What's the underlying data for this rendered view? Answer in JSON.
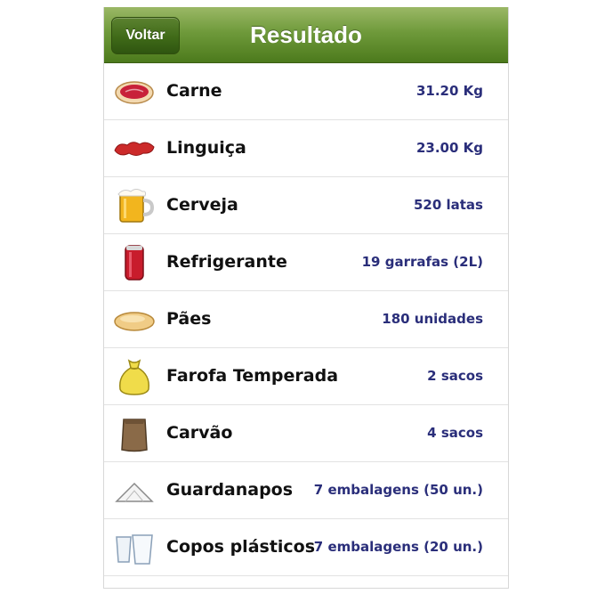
{
  "navbar": {
    "back_label": "Voltar",
    "title": "Resultado",
    "bar_color": "#5e8a2c"
  },
  "items": [
    {
      "label": "Carne",
      "value": "31.20 Kg",
      "icon": "steak-icon"
    },
    {
      "label": "Linguiça",
      "value": "23.00 Kg",
      "icon": "sausage-icon"
    },
    {
      "label": "Cerveja",
      "value": "520 latas",
      "icon": "beer-mug-icon"
    },
    {
      "label": "Refrigerante",
      "value": "19 garrafas (2L)",
      "icon": "soda-can-icon"
    },
    {
      "label": "Pães",
      "value": "180 unidades",
      "icon": "bread-icon"
    },
    {
      "label": "Farofa Temperada",
      "value": "2 sacos",
      "icon": "farofa-sack-icon"
    },
    {
      "label": "Carvão",
      "value": "4 sacos",
      "icon": "charcoal-bag-icon"
    },
    {
      "label": "Guardanapos",
      "value": "7 embalagens (50 un.)",
      "icon": "napkin-icon"
    },
    {
      "label": "Copos plásticos",
      "value": "7 embalagens (20 un.)",
      "icon": "plastic-cups-icon"
    }
  ],
  "colors": {
    "value_text": "#2a2e7a",
    "label_text": "#111111"
  }
}
